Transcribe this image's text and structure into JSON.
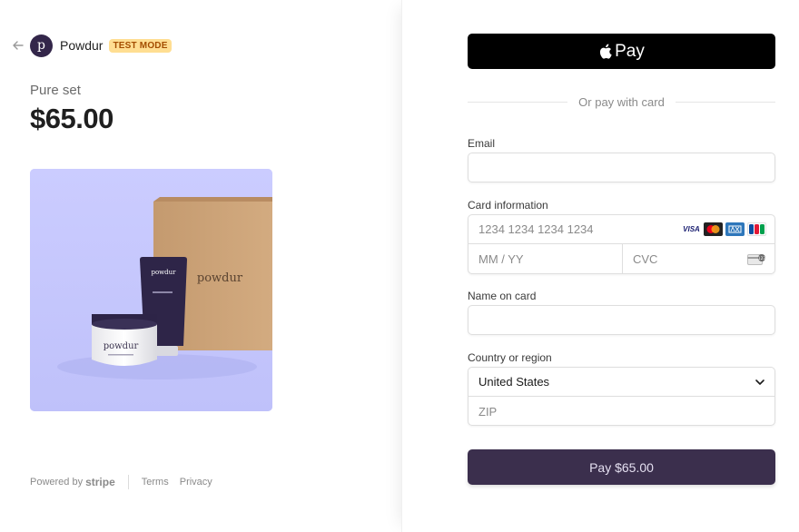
{
  "merchant": {
    "back_icon": "arrow-left-icon",
    "logo_letter": "p",
    "name": "Powdur",
    "mode_badge": "TEST MODE"
  },
  "product": {
    "name": "Pure set",
    "price": "$65.00",
    "image_brand_text": "powdur"
  },
  "footer": {
    "powered_by": "Powered by",
    "stripe": "stripe",
    "terms": "Terms",
    "privacy": "Privacy"
  },
  "payment": {
    "apple_pay_label": "Pay",
    "divider_text": "Or pay with card",
    "email_label": "Email",
    "email_value": "",
    "card_label": "Card information",
    "card_number_placeholder": "1234 1234 1234 1234",
    "expiry_placeholder": "MM / YY",
    "cvc_placeholder": "CVC",
    "card_brands": [
      "VISA",
      "mastercard",
      "amex",
      "JCB"
    ],
    "name_label": "Name on card",
    "name_value": "",
    "country_label": "Country or region",
    "country_value": "United States",
    "zip_placeholder": "ZIP",
    "pay_button": "Pay $65.00"
  },
  "colors": {
    "brand": "#33264a",
    "pay_button": "#3b2f4d",
    "product_bg": "#c9cbff",
    "badge_bg": "#ffde92"
  }
}
